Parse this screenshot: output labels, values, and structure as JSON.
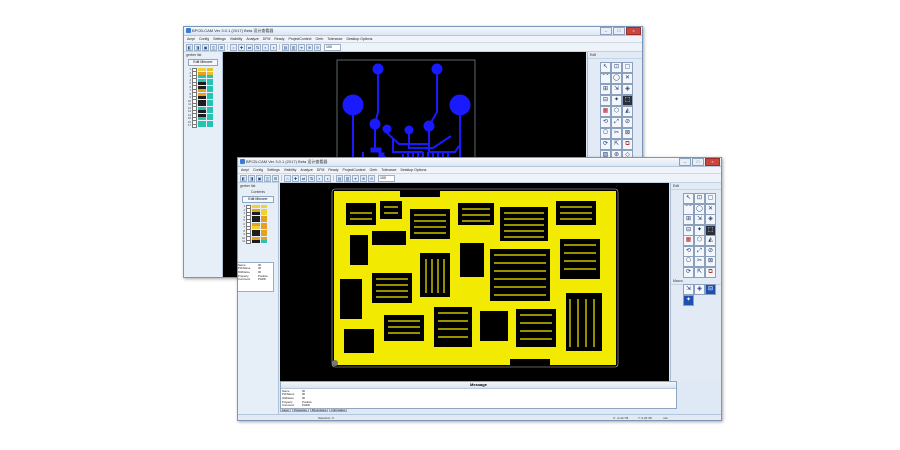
{
  "back_window": {
    "title": "BPCB-CAM Ver 3.0.1 (2017) Beta",
    "title_tag": "设计查看器",
    "menu": [
      "Ampl",
      "Config",
      "Settings",
      "Visibility",
      "Analyze",
      "DFM",
      "Ready",
      "ProjectContext",
      "Gerb",
      "Tolerance",
      "Desktop Options"
    ],
    "zoom": "100",
    "panel_title": "gerber list",
    "panel_button": "Edit Mirrorer",
    "layers": [
      {
        "n": "1",
        "c": "#f0d232",
        "c2": "#e6c22a"
      },
      {
        "n": "2",
        "c": "#e8a020",
        "c2": "#e6c22a"
      },
      {
        "n": "3",
        "c": "#29c1b0",
        "c2": "#29c1b0"
      },
      {
        "n": "4",
        "c": "#29c1b0",
        "c2": "#29c1b0"
      },
      {
        "n": "5",
        "c": "#1d1d1d",
        "c2": "#29c1b0"
      },
      {
        "n": "6",
        "c": "#1d1d1d",
        "c2": "#29c1b0"
      },
      {
        "n": "7",
        "c": "#e8a020",
        "c2": "#29c1b0"
      },
      {
        "n": "8",
        "c": "#e8a020",
        "c2": "#29c1b0"
      },
      {
        "n": "9",
        "c": "#1d1d1d",
        "c2": "#29c1b0"
      },
      {
        "n": "10",
        "c": "#1d1d1d",
        "c2": "#29c1b0"
      },
      {
        "n": "11",
        "c": "#1d1d1d",
        "c2": "#29c1b0"
      },
      {
        "n": "12",
        "c": "#29c1b0",
        "c2": "#29c1b0"
      },
      {
        "n": "13",
        "c": "#1d1d1d",
        "c2": "#29c1b0"
      },
      {
        "n": "14",
        "c": "#1d1d1d",
        "c2": "#29c1b0"
      },
      {
        "n": "15",
        "c": "#29c1b0",
        "c2": "#29c1b0"
      },
      {
        "n": "16",
        "c": "#29c1b0",
        "c2": "#29c1b0"
      },
      {
        "n": "17",
        "c": "#29c1b0",
        "c2": "#29c1b0"
      }
    ],
    "tools_title": "Edit",
    "tools2_title": "Edit"
  },
  "front_window": {
    "title": "BPCB-CAM Ver 3.0.1 (2017) Beta",
    "title_tag": "设计查看器",
    "menu": [
      "Ampl",
      "Config",
      "Settings",
      "Visibility",
      "Analyze",
      "DFM",
      "Ready",
      "ProjectContext",
      "Gerb",
      "Tolerance",
      "Desktop Options"
    ],
    "zoom": "100",
    "panel_title": "gerber list",
    "panel_sub": "Contents",
    "panel_button": "Edit Mirrorer",
    "layers": [
      {
        "n": "1",
        "c": "#f0d232",
        "c2": "#f0d232"
      },
      {
        "n": "2",
        "c": "#e8a020",
        "c2": "#f0d232"
      },
      {
        "n": "3",
        "c": "#1d1d1d",
        "c2": "#f0d232"
      },
      {
        "n": "4",
        "c": "#1d1d1d",
        "c2": "#e8a020"
      },
      {
        "n": "5",
        "c": "#1d1d1d",
        "c2": "#e8a020"
      },
      {
        "n": "6",
        "c": "#e8a020",
        "c2": "#e8a020"
      },
      {
        "n": "7",
        "c": "#f0d232",
        "c2": "#e8a020"
      },
      {
        "n": "8",
        "c": "#1d1d1d",
        "c2": "#e8a020"
      },
      {
        "n": "9",
        "c": "#1d1d1d",
        "c2": "#e8a020"
      },
      {
        "n": "10",
        "c": "#e8a020",
        "c2": "#e8a020"
      },
      {
        "n": "11",
        "c": "#1d1d1d",
        "c2": "#29c1b0"
      }
    ],
    "info": {
      "title": "Name",
      "rows": [
        {
          "k": "Name",
          "v": "00"
        },
        {
          "k": "PcbName",
          "v": "00"
        },
        {
          "k": "OldName",
          "v": "00"
        },
        {
          "k": "Property",
          "v": "Positive"
        },
        {
          "k": "Comment",
          "v": "PHDD"
        }
      ]
    },
    "message": {
      "title": "Message",
      "rows": [
        {
          "k": "Name",
          "v": "00"
        },
        {
          "k": "PcbName",
          "v": "00"
        },
        {
          "k": "OldName",
          "v": "00"
        },
        {
          "k": "Property",
          "v": "Positive"
        },
        {
          "k": "Comment",
          "v": "PHDD"
        }
      ]
    },
    "tabs": [
      "Layer",
      "Properties",
      "Dimensions",
      "Information"
    ],
    "status": {
      "left": "Selection: 0",
      "coord_x": "X: -0.42 YB",
      "coord_y": "Y: 0.25 38",
      "unit": "mm"
    },
    "tools_title": "Edit",
    "tools2_title": "Macro"
  },
  "colors": {
    "gerber_blue": "#1a1aff",
    "gerber_yellow": "#f2ea00",
    "canvas_bg": "#000000",
    "window_frame": "#dfe9f5"
  }
}
